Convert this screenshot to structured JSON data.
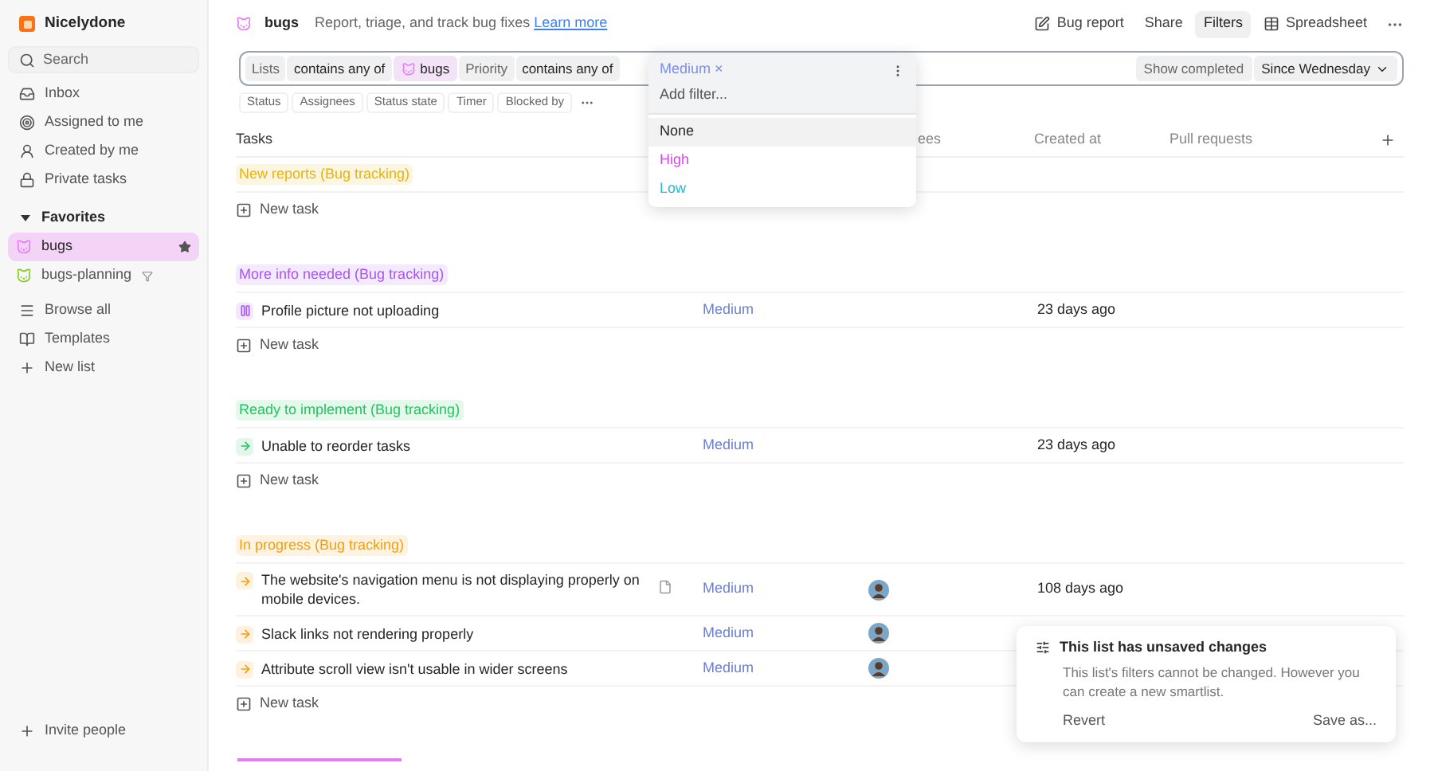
{
  "app": {
    "name": "Nicelydone"
  },
  "sidebar": {
    "search": {
      "placeholder": "Search"
    },
    "nav": [
      {
        "label": "Inbox"
      },
      {
        "label": "Assigned to me"
      },
      {
        "label": "Created by me"
      },
      {
        "label": "Private tasks"
      }
    ],
    "favorites": {
      "title": "Favorites",
      "expanded": true,
      "items": [
        {
          "label": "bugs",
          "selected": true,
          "starred": true,
          "filtered": false,
          "color": "#e879f9"
        },
        {
          "label": "bugs-planning",
          "selected": false,
          "starred": false,
          "filtered": true,
          "color": "#84cc16"
        }
      ]
    },
    "links": [
      {
        "label": "Browse all"
      },
      {
        "label": "Templates"
      },
      {
        "label": "New list"
      }
    ],
    "invite": "Invite people"
  },
  "header": {
    "title": "bugs",
    "description": "Report, triage, and track bug fixes",
    "link": "Learn more",
    "actions": [
      {
        "label": "Bug report",
        "selected": false
      },
      {
        "label": "Share",
        "selected": false
      },
      {
        "label": "Filters",
        "selected": true
      },
      {
        "label": "Spreadsheet",
        "selected": false
      }
    ]
  },
  "filter_bar": {
    "conditions": [
      {
        "field": "Lists",
        "operator": "contains any of",
        "values": [
          {
            "label": "bugs"
          }
        ]
      },
      {
        "field": "Priority",
        "operator": "contains any of"
      }
    ],
    "show_completed": "Show completed",
    "range": "Since Wednesday"
  },
  "dropdown": {
    "tags": [
      {
        "label": "Medium",
        "remove": "×"
      }
    ],
    "placeholder": "Add filter...",
    "options": [
      {
        "label": "None",
        "highlighted": true,
        "color": "#262626"
      },
      {
        "label": "High",
        "highlighted": false,
        "color": "#d946ef"
      },
      {
        "label": "Low",
        "highlighted": false,
        "color": "#22b8cf"
      }
    ]
  },
  "quick_filters": [
    "Status",
    "Assignees",
    "Status state",
    "Timer",
    "Blocked by"
  ],
  "table": {
    "columns": [
      {
        "label": "Tasks"
      },
      {
        "label": "ees"
      },
      {
        "label": "Created at"
      },
      {
        "label": "Pull requests"
      }
    ],
    "groups": [
      {
        "title": "New reports (Bug tracking)",
        "color": "#eab308",
        "new_task": "New task"
      },
      {
        "title": "More info needed (Bug tracking)",
        "kind": "paused",
        "color": "#a855f7",
        "new_task": "New task",
        "tasks": [
          {
            "title": "Profile picture not uploading",
            "priority": "Medium",
            "assigned": false,
            "attachment": false,
            "created_at": "23 days ago"
          }
        ]
      },
      {
        "title": "Ready to implement (Bug tracking)",
        "kind": "ready",
        "color": "#22c55e",
        "new_task": "New task",
        "tasks": [
          {
            "title": "Unable to reorder tasks",
            "priority": "Medium",
            "assigned": false,
            "attachment": false,
            "created_at": "23 days ago"
          }
        ]
      },
      {
        "title": "In progress (Bug tracking)",
        "kind": "progress",
        "color": "#f59e0b",
        "new_task": "New task",
        "tasks": [
          {
            "title": "The website's navigation menu is not displaying properly on mobile devices.",
            "priority": "Medium",
            "assigned": true,
            "attachment": true,
            "created_at": "108 days ago"
          },
          {
            "title": "Slack links not rendering properly",
            "priority": "Medium",
            "assigned": true,
            "attachment": false
          },
          {
            "title": "Attribute scroll view isn't usable in wider screens",
            "priority": "Medium",
            "assigned": true,
            "attachment": false
          }
        ]
      }
    ]
  },
  "toast": {
    "title": "This list has unsaved changes",
    "body": "This list's filters cannot be changed. However you can create a new smartlist.",
    "actions": [
      {
        "label": "Revert"
      },
      {
        "label": "Save as..."
      }
    ]
  }
}
